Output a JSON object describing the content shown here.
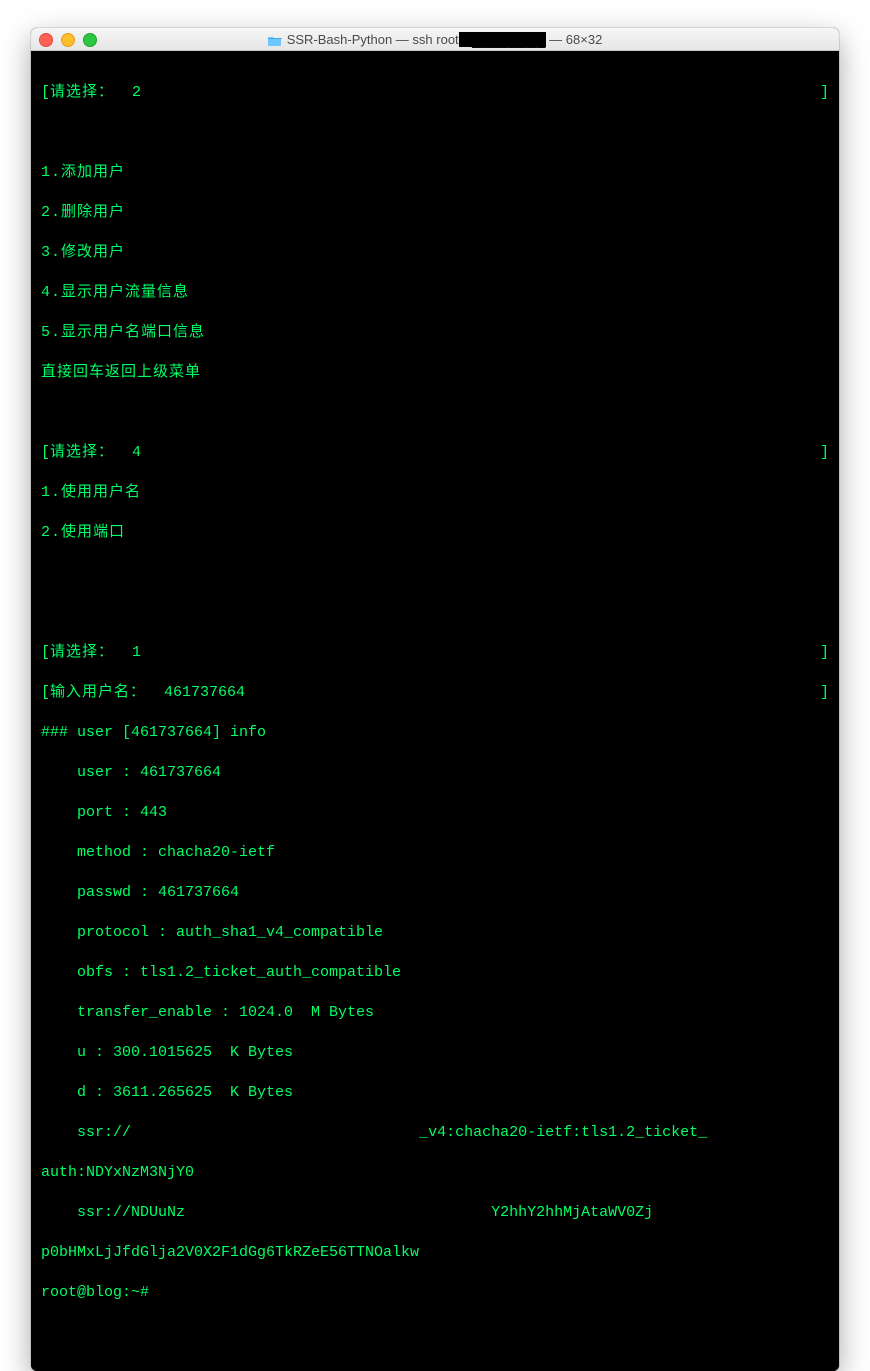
{
  "titlebar": {
    "folder": "SSR-Bash-Python",
    "sep1": " — ",
    "ssh_prefix": "ssh root",
    "ssh_redacted": "@████████",
    "sep2": " — ",
    "size": "68×32"
  },
  "term": {
    "prompt1_label": "请选择：",
    "prompt1_value": "2",
    "bracket_l": "[",
    "bracket_r": "]",
    "menu1": {
      "i1": "1.添加用户",
      "i2": "2.删除用户",
      "i3": "3.修改用户",
      "i4": "4.显示用户流量信息",
      "i5": "5.显示用户名端口信息",
      "back": "直接回车返回上级菜单"
    },
    "prompt2_label": "请选择：",
    "prompt2_value": "4",
    "menu2": {
      "i1": "1.使用用户名",
      "i2": "2.使用端口"
    },
    "prompt3_label": "请选择：",
    "prompt3_value": "1",
    "input_user_label": "输入用户名：",
    "input_user_value": "461737664",
    "info_header": "### user [461737664] info",
    "row_user": "    user : 461737664",
    "row_port": "    port : 443",
    "row_method": "    method : chacha20-ietf",
    "row_passwd": "    passwd : 461737664",
    "row_protocol": "    protocol : auth_sha1_v4_compatible",
    "row_obfs": "    obfs : tls1.2_ticket_auth_compatible",
    "row_transfer": "    transfer_enable : 1024.0  M Bytes",
    "row_u": "    u : 300.1015625  K Bytes",
    "row_d": "    d : 3611.265625  K Bytes",
    "ssr1_a": "    ssr://",
    "ssr1_b": "_v4:chacha20-ietf:tls1.2_ticket_",
    "ssr1_wrap": "auth:NDYxNzM3NjY0",
    "ssr2_a": "    ssr://NDUuNz",
    "ssr2_b": "Y2hhY2hhMjAtaWV0Zj",
    "ssr2_wrap": "p0bHMxLjJfdGlja2V0X2F1dGg6TkRZeE56TTNOalkw",
    "shell_prompt": "root@blog:~#"
  }
}
